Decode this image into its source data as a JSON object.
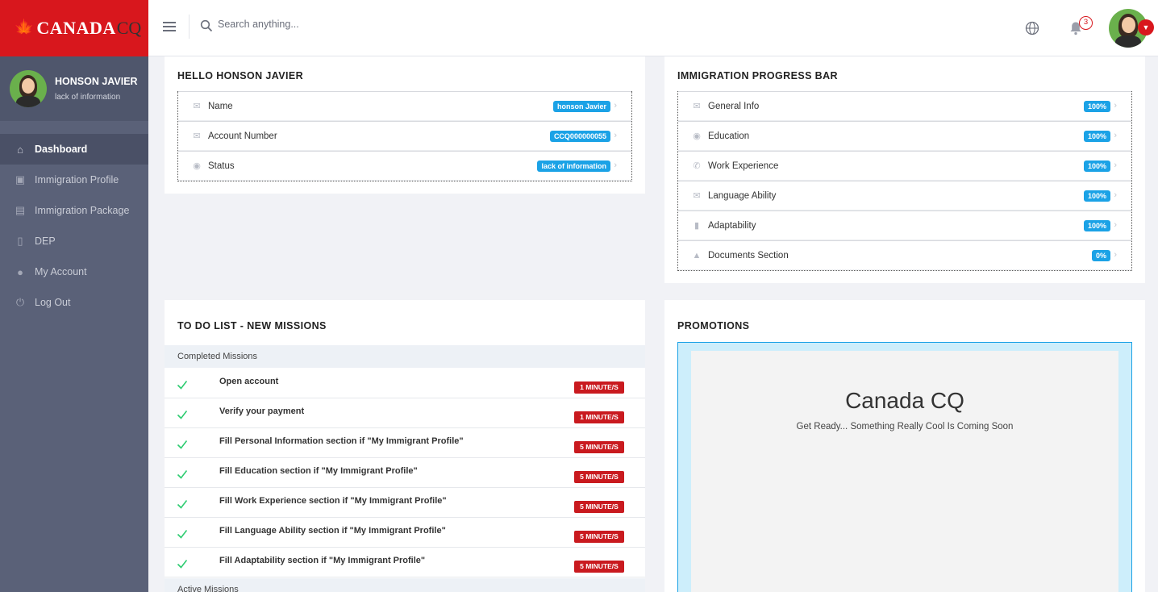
{
  "brand": {
    "name": "CANADA",
    "suffix": "CQ"
  },
  "user": {
    "name": "HONSON JAVIER",
    "status": "lack of information"
  },
  "nav": [
    {
      "label": "Dashboard",
      "icon": "home-icon",
      "active": true
    },
    {
      "label": "Immigration Profile",
      "icon": "briefcase-icon"
    },
    {
      "label": "Immigration Package",
      "icon": "clipboard-icon"
    },
    {
      "label": "DEP",
      "icon": "document-icon"
    },
    {
      "label": "My Account",
      "icon": "user-icon"
    },
    {
      "label": "Log Out",
      "icon": "power-icon"
    }
  ],
  "topbar": {
    "search_placeholder": "Search anything...",
    "notification_count": "3"
  },
  "hello": {
    "title": "HELLO HONSON JAVIER",
    "rows": [
      {
        "label": "Name",
        "value": "honson Javier",
        "icon": "mail-icon"
      },
      {
        "label": "Account Number",
        "value": "CCQ000000055",
        "icon": "mail-icon"
      },
      {
        "label": "Status",
        "value": "lack of information",
        "icon": "eye-icon"
      }
    ]
  },
  "progress": {
    "title": "IMMIGRATION PROGRESS BAR",
    "rows": [
      {
        "label": "General Info",
        "value": "100%",
        "icon": "mail-icon"
      },
      {
        "label": "Education",
        "value": "100%",
        "icon": "eye-icon"
      },
      {
        "label": "Work Experience",
        "value": "100%",
        "icon": "phone-icon"
      },
      {
        "label": "Language Ability",
        "value": "100%",
        "icon": "mail-icon"
      },
      {
        "label": "Adaptability",
        "value": "100%",
        "icon": "bookmark-icon"
      },
      {
        "label": "Documents Section",
        "value": "0%",
        "icon": "bell-icon"
      }
    ]
  },
  "todo": {
    "title": "TO DO LIST - NEW MISSIONS",
    "completed_label": "Completed Missions",
    "active_label": "Active Missions",
    "completed": [
      {
        "text": "Open account",
        "time": "1 MINUTE/S"
      },
      {
        "text": "Verify your payment",
        "time": "1 MINUTE/S"
      },
      {
        "text": "Fill Personal Information section if \"My Immigrant Profile\"",
        "time": "5 MINUTE/S"
      },
      {
        "text": "Fill Education section if \"My Immigrant Profile\"",
        "time": "5 MINUTE/S"
      },
      {
        "text": "Fill Work Experience section if \"My Immigrant Profile\"",
        "time": "5 MINUTE/S"
      },
      {
        "text": "Fill Language Ability section if \"My Immigrant Profile\"",
        "time": "5 MINUTE/S"
      },
      {
        "text": "Fill Adaptability section if \"My Immigrant Profile\"",
        "time": "5 MINUTE/S"
      }
    ]
  },
  "promotions": {
    "title": "PROMOTIONS",
    "headline": "Canada CQ",
    "subline": "Get Ready... Something Really Cool Is Coming Soon"
  },
  "colors": {
    "brand_red": "#d8171d",
    "sidebar": "#5a6178",
    "badge_blue": "#1ba2e6",
    "check_green": "#2ecc71"
  }
}
